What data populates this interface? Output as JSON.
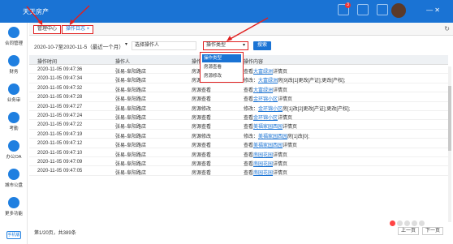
{
  "app": {
    "title": "天天房产"
  },
  "header": {
    "message_badge": "3"
  },
  "sidebar": {
    "items": [
      {
        "label": "合同管理",
        "icon": "contract-icon"
      },
      {
        "label": "财务",
        "icon": "finance-icon"
      },
      {
        "label": "业务审",
        "icon": "review-icon"
      },
      {
        "label": "考勤",
        "icon": "attendance-icon"
      },
      {
        "label": "办公OA",
        "icon": "oa-icon"
      },
      {
        "label": "城市公盘",
        "icon": "city-icon"
      },
      {
        "label": "更多功能",
        "icon": "more-icon"
      }
    ],
    "mobile_label": "手机版"
  },
  "tabs": [
    {
      "label": "管理中心"
    },
    {
      "label": "操作日志"
    }
  ],
  "filters": {
    "date_range": "2020-10-7至2020-11-5（最近一个月）",
    "operator_placeholder": "选择操作人",
    "type_selected": "操作类型",
    "search_label": "搜索"
  },
  "dropdown": {
    "options": [
      "操作类型",
      "房源查看",
      "房源修改"
    ]
  },
  "table": {
    "headers": [
      "操作时间",
      "操作人",
      "操作类型",
      "操作内容"
    ],
    "rows": [
      [
        "2020-11-05 09:47:36",
        "张易-阜阳路店",
        "房源查看",
        "查看",
        "大富绿洲",
        "详情页"
      ],
      [
        "2020-11-05 09:47:34",
        "张易-阜阳路店",
        "房源修改",
        "修改：",
        "大富绿洲",
        "房[9]改[1]更改[产证];更改[产权];"
      ],
      [
        "2020-11-05 09:47:32",
        "张易-阜阳路店",
        "房源查看",
        "查看",
        "大富绿洲",
        "详情页"
      ],
      [
        "2020-11-05 09:47:28",
        "张易-阜阳路店",
        "房源查看",
        "查看",
        "金环锦小区",
        "详情页"
      ],
      [
        "2020-11-05 09:47:27",
        "张易-阜阳路店",
        "房源修改",
        "修改：",
        "金环锦小区",
        "房[1]改[2]更改[产证];更改[产权];"
      ],
      [
        "2020-11-05 09:47:24",
        "张易-阜阳路店",
        "房源查看",
        "查看",
        "金环锦小区",
        "详情页"
      ],
      [
        "2020-11-05 09:47:22",
        "张易-阜阳路店",
        "房源查看",
        "查看",
        "美福家园西园",
        "详情页"
      ],
      [
        "2020-11-05 09:47:19",
        "张易-阜阳路店",
        "房源修改",
        "修改：",
        "美福家园西园",
        "房[1]改[0];"
      ],
      [
        "2020-11-05 09:47:12",
        "张易-阜阳路店",
        "房源查看",
        "查看",
        "美福家园西园",
        "详情页"
      ],
      [
        "2020-11-05 09:47:10",
        "张易-阜阳路店",
        "房源查看",
        "查看",
        "南园花园",
        "详情页"
      ],
      [
        "2020-11-05 09:47:09",
        "张易-阜阳路店",
        "房源查看",
        "查看",
        "南园花园",
        "详情页"
      ],
      [
        "2020-11-05 09:47:05",
        "张易-阜阳路店",
        "房源查看",
        "查看",
        "南园花园",
        "详情页"
      ]
    ]
  },
  "footer": {
    "pager_info": "第1/20页，共389条",
    "prev_label": "上一页",
    "next_label": "下一页"
  },
  "colors": {
    "primary": "#1a73d4",
    "highlight": "#e02020"
  }
}
